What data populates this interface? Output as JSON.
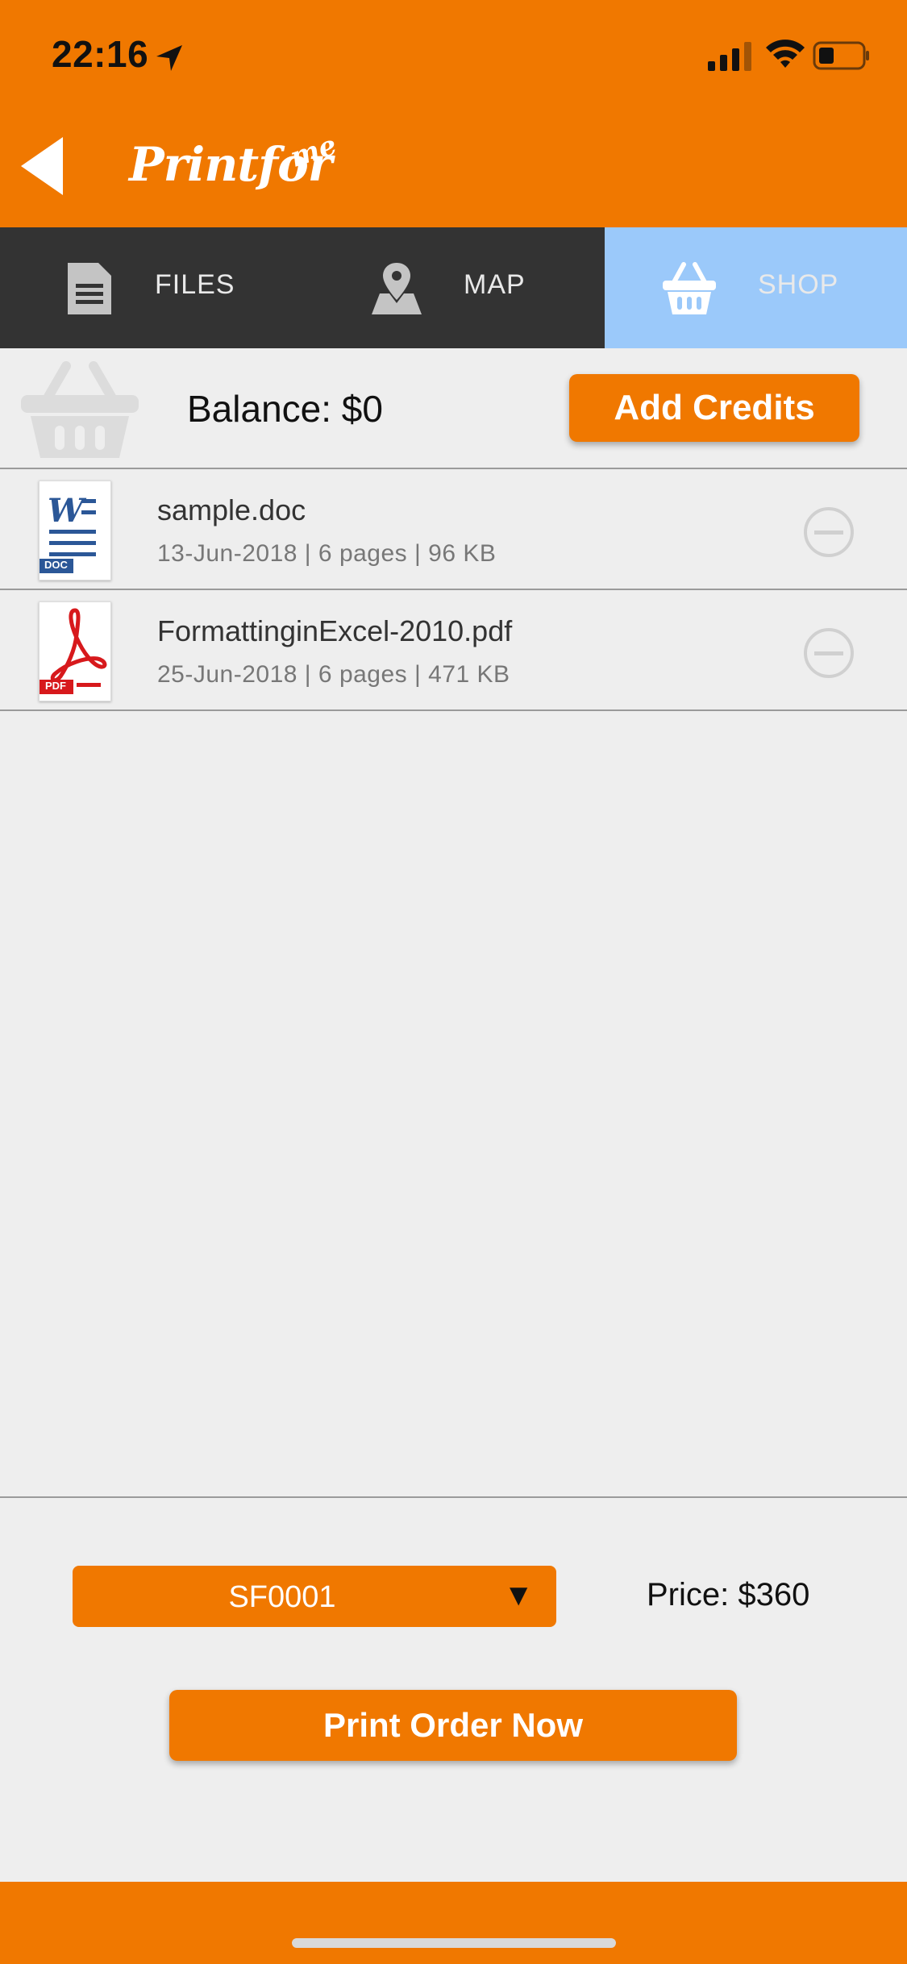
{
  "status_bar": {
    "time": "22:16"
  },
  "header": {
    "logo_text": "Printfor",
    "logo_suffix": "me"
  },
  "tabs": [
    {
      "label": "FILES",
      "icon": "document-icon",
      "active": false
    },
    {
      "label": "MAP",
      "icon": "map-pin-icon",
      "active": false
    },
    {
      "label": "SHOP",
      "icon": "basket-icon",
      "active": true
    }
  ],
  "balance": {
    "text": "Balance: $0",
    "add_credits_label": "Add Credits"
  },
  "files": [
    {
      "name": "sample.doc",
      "meta": "13-Jun-2018 | 6 pages | 96 KB",
      "type_badge": "DOC",
      "icon": "word-doc-icon"
    },
    {
      "name": "FormattinginExcel-2010.pdf",
      "meta": "25-Jun-2018 | 6 pages | 471 KB",
      "type_badge": "PDF",
      "icon": "pdf-icon"
    }
  ],
  "order": {
    "selected_code": "SF0001",
    "price_text": "Price: $360",
    "print_label": "Print Order Now"
  },
  "colors": {
    "accent": "#f07800",
    "tab_bar": "#333333",
    "active_tab": "#9bc9fa",
    "background": "#eeeeee"
  }
}
